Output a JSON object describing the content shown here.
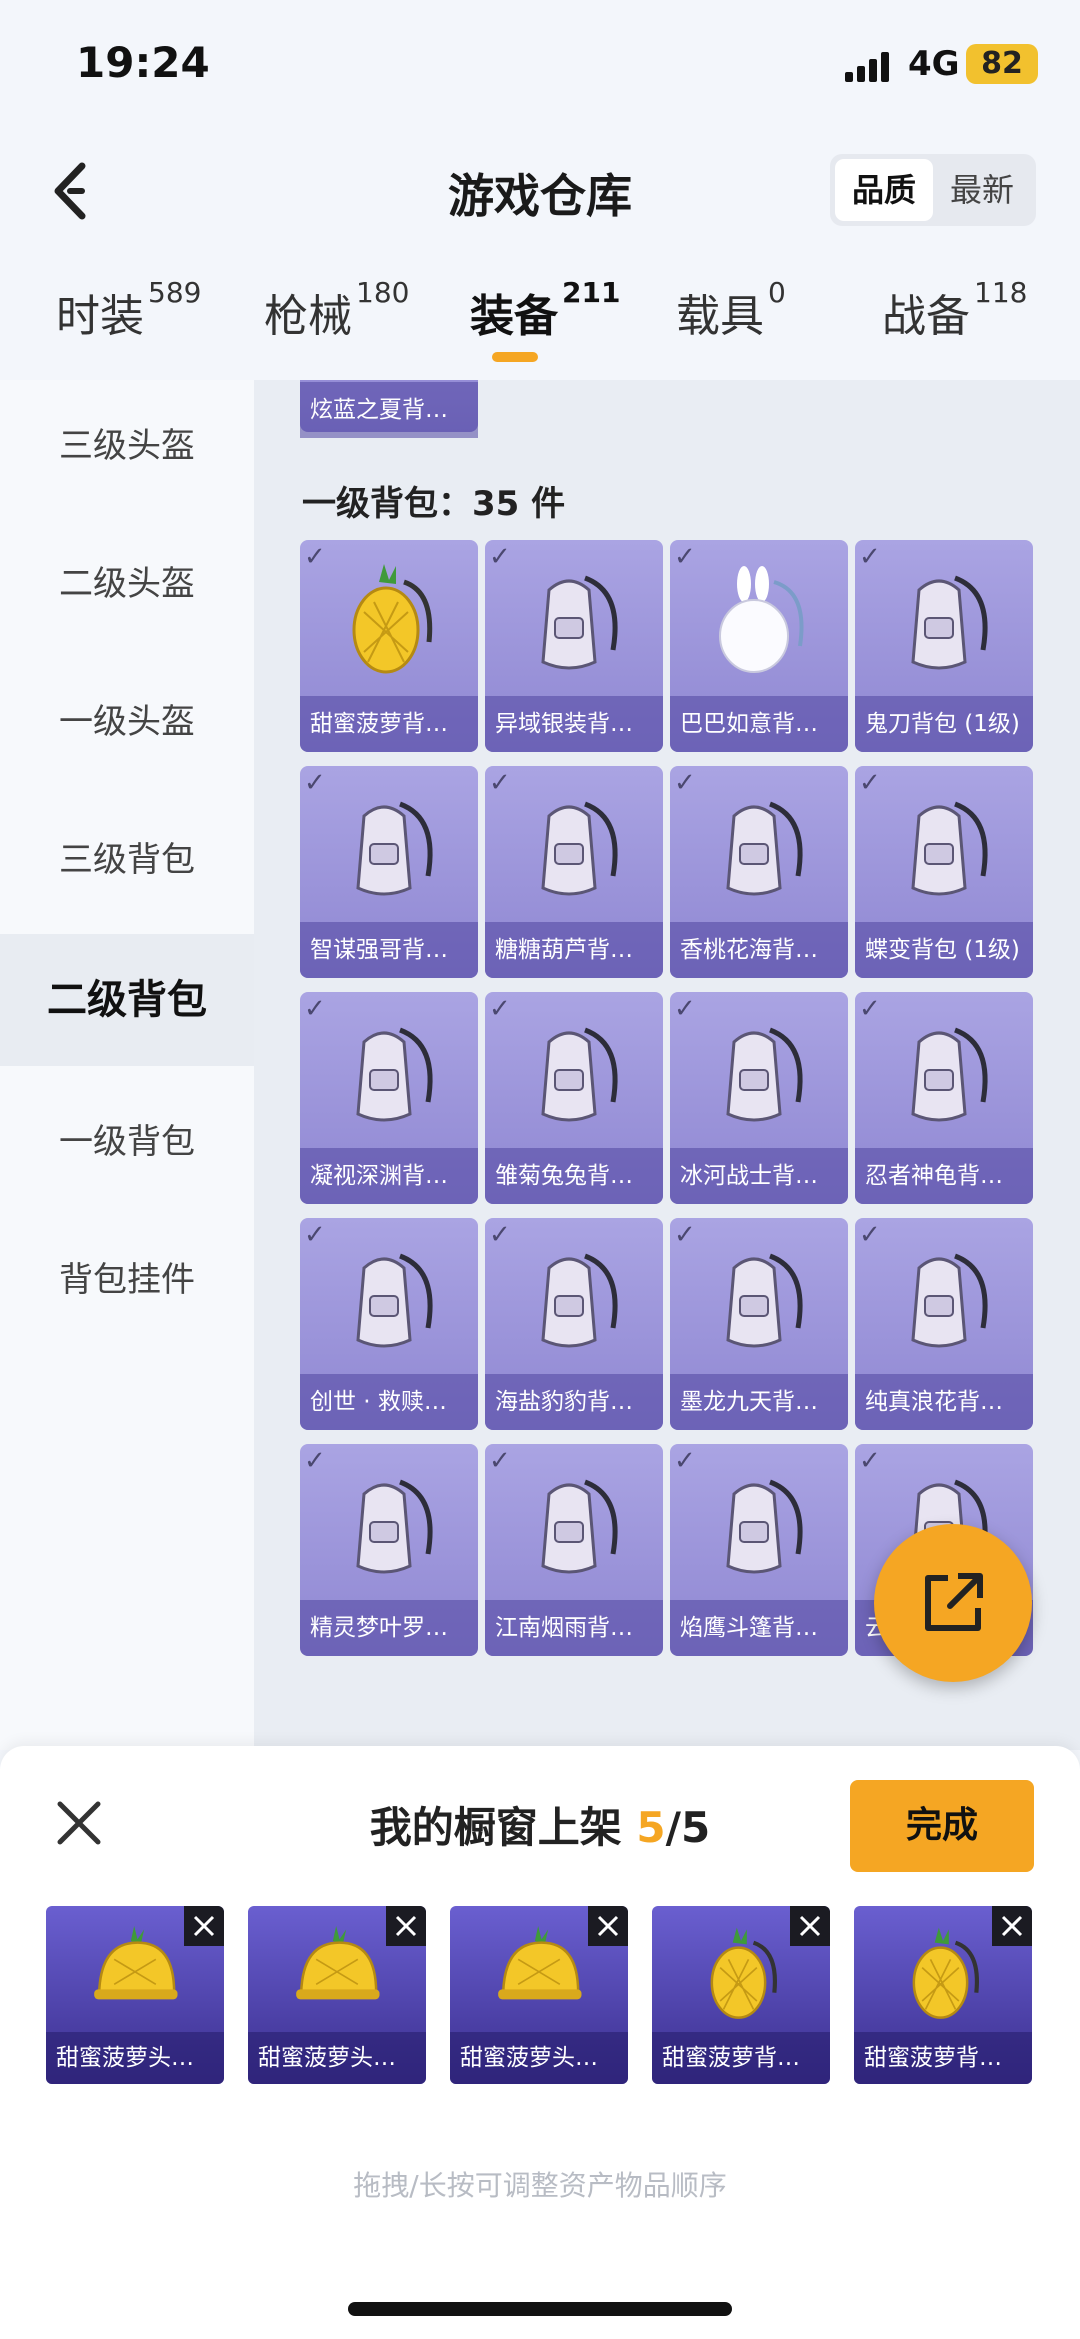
{
  "status": {
    "time": "19:24",
    "network": "4G",
    "battery": "82"
  },
  "header": {
    "title": "游戏仓库",
    "sort_options": [
      "品质",
      "最新"
    ]
  },
  "tabs": [
    {
      "label": "时装",
      "count": "589"
    },
    {
      "label": "枪械",
      "count": "180"
    },
    {
      "label": "装备",
      "count": "211"
    },
    {
      "label": "载具",
      "count": "0"
    },
    {
      "label": "战备",
      "count": "118"
    }
  ],
  "sidebar": {
    "items": [
      {
        "label": "三级头盔"
      },
      {
        "label": "二级头盔"
      },
      {
        "label": "一级头盔"
      },
      {
        "label": "三级背包"
      },
      {
        "label": "二级背包"
      },
      {
        "label": "一级背包"
      },
      {
        "label": "背包挂件"
      }
    ]
  },
  "content": {
    "prev_item": "炫蓝之夏背…",
    "section_label": "一级背包：35 件",
    "items": [
      {
        "label": "甜蜜菠萝背…",
        "icon": "pineapple-backpack"
      },
      {
        "label": "异域银装背…",
        "icon": "backpack"
      },
      {
        "label": "巴巴如意背…",
        "icon": "bunny-backpack"
      },
      {
        "label": "鬼刀背包 (1级)",
        "icon": "backpack"
      },
      {
        "label": "智谋强哥背…",
        "icon": "backpack"
      },
      {
        "label": "糖糖葫芦背…",
        "icon": "backpack"
      },
      {
        "label": "香桃花海背…",
        "icon": "backpack"
      },
      {
        "label": "蝶变背包 (1级)",
        "icon": "backpack"
      },
      {
        "label": "凝视深渊背…",
        "icon": "backpack"
      },
      {
        "label": "雏菊兔兔背…",
        "icon": "backpack"
      },
      {
        "label": "冰河战士背…",
        "icon": "backpack"
      },
      {
        "label": "忍者神龟背…",
        "icon": "backpack"
      },
      {
        "label": "创世 · 救赎…",
        "icon": "backpack"
      },
      {
        "label": "海盐豹豹背…",
        "icon": "backpack"
      },
      {
        "label": "墨龙九天背…",
        "icon": "backpack"
      },
      {
        "label": "纯真浪花背…",
        "icon": "backpack"
      },
      {
        "label": "精灵梦叶罗…",
        "icon": "backpack"
      },
      {
        "label": "江南烟雨背…",
        "icon": "backpack"
      },
      {
        "label": "焰鹰斗篷背…",
        "icon": "backpack"
      },
      {
        "label": "云…",
        "icon": "backpack"
      }
    ]
  },
  "panel": {
    "title_prefix": "我的橱窗上架 ",
    "count": "5",
    "total": "/5",
    "done_label": "完成",
    "showcase": [
      {
        "label": "甜蜜菠萝头…",
        "icon": "pineapple-helmet"
      },
      {
        "label": "甜蜜菠萝头…",
        "icon": "pineapple-helmet"
      },
      {
        "label": "甜蜜菠萝头…",
        "icon": "pineapple-helmet"
      },
      {
        "label": "甜蜜菠萝背…",
        "icon": "pineapple-backpack"
      },
      {
        "label": "甜蜜菠萝背…",
        "icon": "pineapple-backpack"
      }
    ],
    "hint": "拖拽/长按可调整资产物品顺序"
  },
  "colors": {
    "accent": "#f5a623",
    "card": "#9b94dc",
    "showcase_card": "#4a3fb0"
  }
}
